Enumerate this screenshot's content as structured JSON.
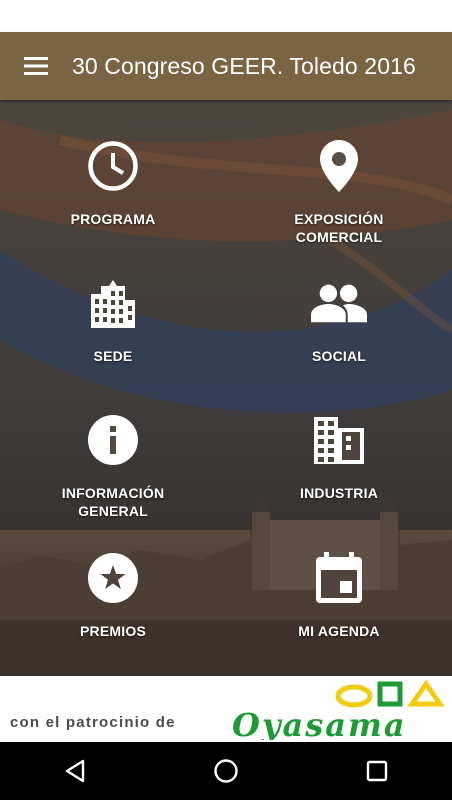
{
  "app_bar": {
    "title": "30 Congreso GEER. Toledo 2016",
    "menu_icon": "hamburger-menu-icon"
  },
  "tiles": [
    {
      "label": "PROGRAMA",
      "icon": "clock-icon"
    },
    {
      "label": "EXPOSICIÓN\nCOMERCIAL",
      "icon": "map-pin-icon"
    },
    {
      "label": "SEDE",
      "icon": "building-icon"
    },
    {
      "label": "SOCIAL",
      "icon": "people-icon"
    },
    {
      "label": "INFORMACIÓN\nGENERAL",
      "icon": "info-icon"
    },
    {
      "label": "INDUSTRIA",
      "icon": "office-building-icon"
    },
    {
      "label": "PREMIOS",
      "icon": "star-icon"
    },
    {
      "label": "MI AGENDA",
      "icon": "calendar-icon"
    }
  ],
  "sponsor": {
    "text": "con el patrocinio de",
    "logo_text": "Oyasama"
  },
  "nav_bar": {
    "buttons": [
      "back-icon",
      "home-icon",
      "recents-icon"
    ]
  },
  "colors": {
    "app_bar": "#7a6444",
    "tile_text": "#ffffff",
    "logo_green": "#1f9b35",
    "logo_yellow": "#f0cd10"
  }
}
